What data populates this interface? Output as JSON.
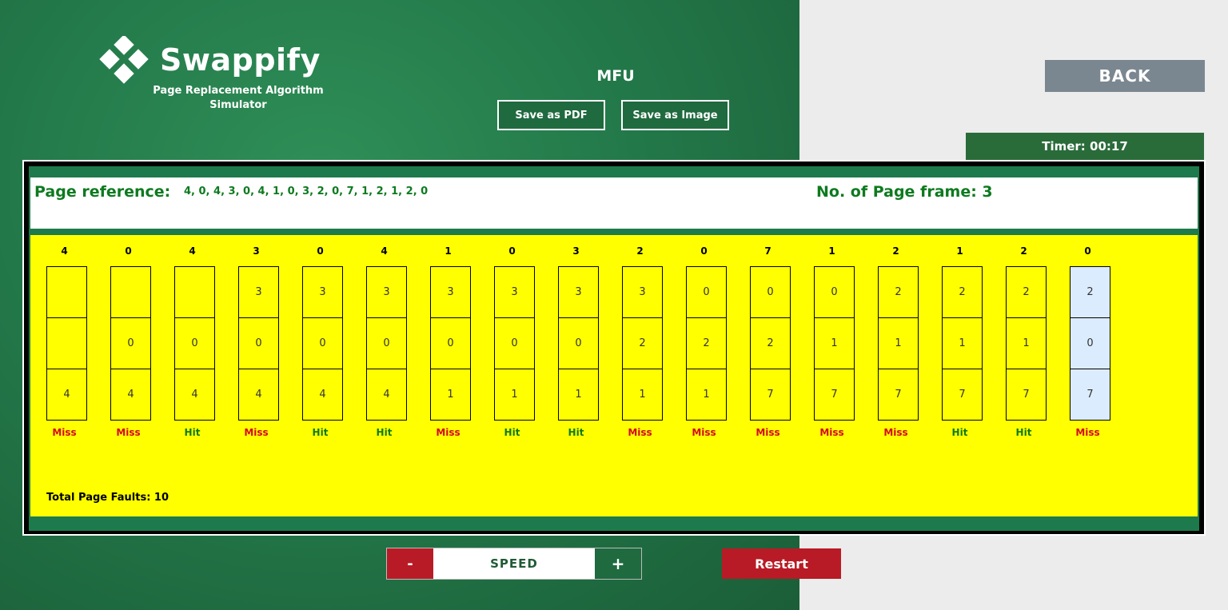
{
  "app": {
    "name": "Swappify",
    "subtitle": "Page Replacement Algorithm Simulator",
    "algorithm": "MFU"
  },
  "toolbar": {
    "save_pdf": "Save as PDF",
    "save_image": "Save as Image",
    "back": "BACK",
    "timer": "Timer: 00:17"
  },
  "info": {
    "ref_label": "Page reference:",
    "ref_values": "4, 0, 4, 3, 0, 4, 1, 0, 3, 2, 0, 7, 1, 2, 1, 2, 0",
    "frame_count": "No. of Page frame: 3"
  },
  "steps": [
    {
      "page": "4",
      "frames": [
        "",
        "",
        "4"
      ],
      "status": "Miss"
    },
    {
      "page": "0",
      "frames": [
        "",
        "0",
        "4"
      ],
      "status": "Miss"
    },
    {
      "page": "4",
      "frames": [
        "",
        "0",
        "4"
      ],
      "status": "Hit"
    },
    {
      "page": "3",
      "frames": [
        "3",
        "0",
        "4"
      ],
      "status": "Miss"
    },
    {
      "page": "0",
      "frames": [
        "3",
        "0",
        "4"
      ],
      "status": "Hit"
    },
    {
      "page": "4",
      "frames": [
        "3",
        "0",
        "4"
      ],
      "status": "Hit"
    },
    {
      "page": "1",
      "frames": [
        "3",
        "0",
        "1"
      ],
      "status": "Miss"
    },
    {
      "page": "0",
      "frames": [
        "3",
        "0",
        "1"
      ],
      "status": "Hit"
    },
    {
      "page": "3",
      "frames": [
        "3",
        "0",
        "1"
      ],
      "status": "Hit"
    },
    {
      "page": "2",
      "frames": [
        "3",
        "2",
        "1"
      ],
      "status": "Miss"
    },
    {
      "page": "0",
      "frames": [
        "0",
        "2",
        "1"
      ],
      "status": "Miss"
    },
    {
      "page": "7",
      "frames": [
        "0",
        "2",
        "7"
      ],
      "status": "Miss"
    },
    {
      "page": "1",
      "frames": [
        "0",
        "1",
        "7"
      ],
      "status": "Miss"
    },
    {
      "page": "2",
      "frames": [
        "2",
        "1",
        "7"
      ],
      "status": "Miss"
    },
    {
      "page": "1",
      "frames": [
        "2",
        "1",
        "7"
      ],
      "status": "Hit"
    },
    {
      "page": "2",
      "frames": [
        "2",
        "1",
        "7"
      ],
      "status": "Hit"
    },
    {
      "page": "0",
      "frames": [
        "2",
        "0",
        "7"
      ],
      "status": "Miss"
    }
  ],
  "total_faults": "Total Page Faults: 10",
  "controls": {
    "minus": "-",
    "speed": "SPEED",
    "plus": "+",
    "restart": "Restart"
  },
  "colors": {
    "accent_green": "#1f6a3f",
    "miss_red": "#d40a1a",
    "hit_green": "#107a10",
    "grid_yellow": "#ffff00",
    "current_highlight": "#dcecff"
  }
}
